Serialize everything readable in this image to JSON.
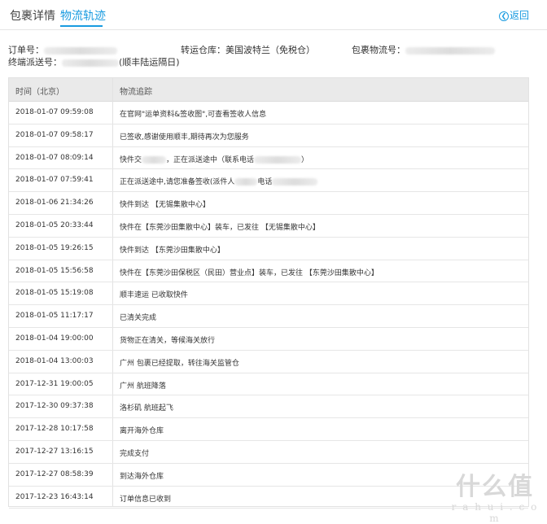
{
  "tabs": [
    {
      "label": "包裹详情",
      "active": false
    },
    {
      "label": "物流轨迹",
      "active": true
    }
  ],
  "back_label": "返回",
  "info": {
    "order_label": "订单号：",
    "warehouse_label": "转运仓库：",
    "warehouse_value": "美国波特兰（免税仓）",
    "tracking_label": "包裹物流号：",
    "final_label": "终端派送号：",
    "final_suffix": "(顺丰陆运隔日)"
  },
  "table": {
    "headers": [
      "时间（北京）",
      "物流追踪"
    ],
    "rows": [
      {
        "time": "2018-01-07 09:59:08",
        "desc": "在官网\"运单资料&签收图\",可查看签收人信息"
      },
      {
        "time": "2018-01-07 09:58:17",
        "desc": "已签收,感谢使用顺丰,期待再次为您服务"
      },
      {
        "time": "2018-01-07 08:09:14",
        "desc": "快件交",
        "desc2": "，正在派送途中（联系电话",
        "desc3": "）"
      },
      {
        "time": "2018-01-07 07:59:41",
        "desc": "正在派送途中,请您准备签收(派件人",
        "desc2": "电话"
      },
      {
        "time": "2018-01-06 21:34:26",
        "desc": "快件到达 【无锡集散中心】"
      },
      {
        "time": "2018-01-05 20:33:44",
        "desc": "快件在【东莞沙田集散中心】装车，已发往 【无锡集散中心】"
      },
      {
        "time": "2018-01-05 19:26:15",
        "desc": "快件到达 【东莞沙田集散中心】"
      },
      {
        "time": "2018-01-05 15:56:58",
        "desc": "快件在【东莞沙田保税区（民田）营业点】装车，已发往 【东莞沙田集散中心】"
      },
      {
        "time": "2018-01-05 15:19:08",
        "desc": "顺丰速运 已收取快件"
      },
      {
        "time": "2018-01-05 11:17:17",
        "desc": "已清关完成"
      },
      {
        "time": "2018-01-04 19:00:00",
        "desc": "货物正在清关，等候海关放行"
      },
      {
        "time": "2018-01-04 13:00:03",
        "desc": "广州 包裹已经提取，转往海关监管仓"
      },
      {
        "time": "2017-12-31 19:00:05",
        "desc": "广州 航班降落"
      },
      {
        "time": "2017-12-30 09:37:38",
        "desc": "洛杉矶 航班起飞"
      },
      {
        "time": "2017-12-28 10:17:58",
        "desc": "离开海外仓库"
      },
      {
        "time": "2017-12-27 13:16:15",
        "desc": "完成支付"
      },
      {
        "time": "2017-12-27 08:58:39",
        "desc": "到达海外仓库"
      },
      {
        "time": "2017-12-23 16:43:14",
        "desc": "订单信息已收到"
      }
    ]
  },
  "watermark": {
    "big": "什么值",
    "small": "r a h u i . c o m"
  },
  "colors": {
    "accent": "#1a9be0",
    "header_bg": "#eaeaea",
    "border": "#e2e2e2"
  }
}
